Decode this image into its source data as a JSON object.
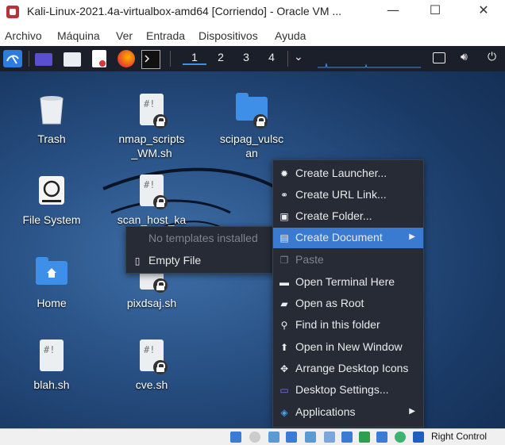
{
  "window": {
    "title": "Kali-Linux-2021.4a-virtualbox-amd64 [Corriendo] - Oracle VM ...",
    "minimize": "—",
    "maximize": "☐",
    "close": "✕"
  },
  "host_menu": [
    "Archivo",
    "Máquina",
    "Ver",
    "Entrada",
    "Dispositivos",
    "Ayuda"
  ],
  "panel": {
    "workspaces": [
      "1",
      "2",
      "3",
      "4"
    ],
    "active_workspace": "1",
    "launchers": [
      "kali-menu-icon",
      "show-desktop-icon",
      "file-manager-icon",
      "text-editor-icon",
      "firefox-icon",
      "terminal-icon"
    ]
  },
  "desktop_icons": [
    {
      "label": "Trash",
      "icon": "trash-icon"
    },
    {
      "label": "nmap_scripts_WM.sh",
      "label_lines": [
        "nmap_scripts",
        "_WM.sh"
      ],
      "icon": "script-file-icon"
    },
    {
      "label": "scipag_vulscan",
      "label_lines": [
        "scipag_vulsc",
        "an"
      ],
      "icon": "folder-icon"
    },
    {
      "label": "File System",
      "icon": "drive-icon"
    },
    {
      "label": "scan_host_ka",
      "icon": "script-file-icon"
    },
    {
      "label": "Home",
      "icon": "home-folder-icon"
    },
    {
      "label": "pixdsaj.sh",
      "icon": "script-file-icon"
    },
    {
      "label": "blah.sh",
      "icon": "script-file-icon"
    },
    {
      "label": "cve.sh",
      "icon": "script-file-icon"
    }
  ],
  "context_menu": [
    {
      "label": "Create Launcher...",
      "icon": "gear-icon",
      "glyph": "✹"
    },
    {
      "label": "Create URL Link...",
      "icon": "link-icon",
      "glyph": "⚭"
    },
    {
      "label": "Create Folder...",
      "icon": "new-folder-icon",
      "glyph": "▣"
    },
    {
      "label": "Create Document",
      "icon": "new-document-icon",
      "glyph": "▤",
      "highlighted": true,
      "submenu": true
    },
    {
      "label": "Paste",
      "icon": "paste-icon",
      "glyph": "❐",
      "disabled": true
    },
    {
      "label": "Open Terminal Here",
      "icon": "terminal-icon",
      "glyph": "▬"
    },
    {
      "label": "Open as Root",
      "icon": "folder-icon",
      "glyph": "▰"
    },
    {
      "label": "Find in this folder",
      "icon": "search-icon",
      "glyph": "⚲"
    },
    {
      "label": "Open in New Window",
      "icon": "upload-icon",
      "glyph": "⬆"
    },
    {
      "label": "Arrange Desktop Icons",
      "icon": "arrange-icon",
      "glyph": "✥"
    },
    {
      "label": "Desktop Settings...",
      "icon": "settings-icon",
      "glyph": "▭"
    },
    {
      "label": "Applications",
      "icon": "applications-icon",
      "glyph": "◈",
      "submenu": true
    }
  ],
  "submenu": {
    "header": "No templates installed",
    "items": [
      {
        "label": "Empty File",
        "icon": "file-icon",
        "glyph": "▯"
      }
    ]
  },
  "statusbar": {
    "host_key": "Right Control"
  },
  "colors": {
    "highlight": "#3b7ad1",
    "menu_bg": "#262b35",
    "panel_bg": "#1b1f29"
  }
}
